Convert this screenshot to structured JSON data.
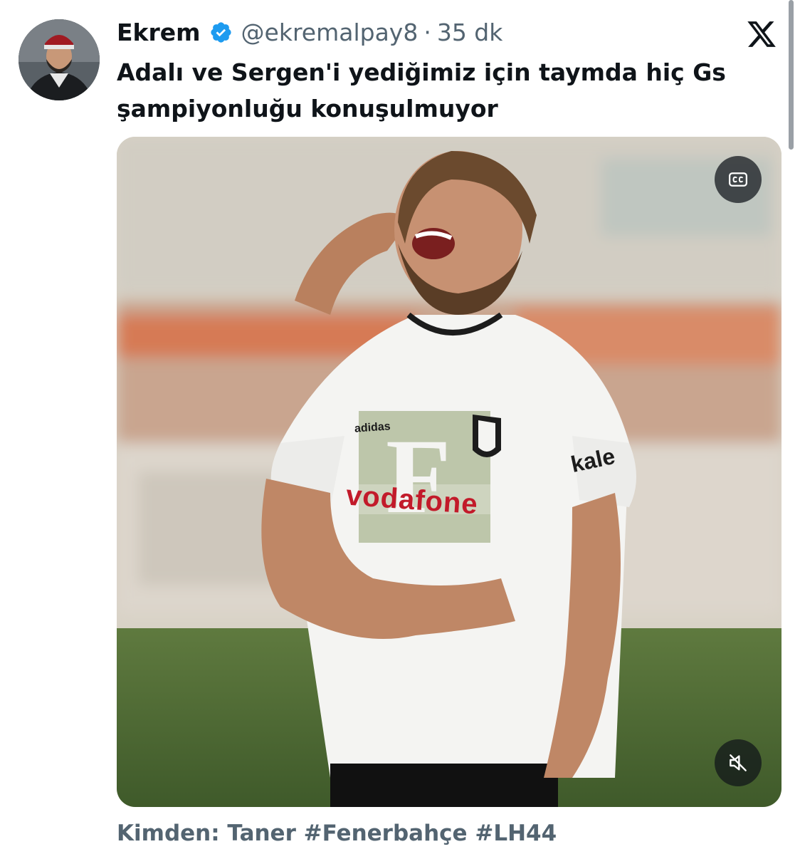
{
  "tweet": {
    "author": {
      "display_name": "Ekrem",
      "handle": "@ekremalpay8",
      "verified": true
    },
    "separator": "·",
    "time": "35 dk",
    "text": "Adalı ve Sergen'i yediğimiz için taymda hiç Gs şampiyonluğu konuşulmuyor",
    "media": {
      "type": "video",
      "watermark_letter": "F",
      "jersey_sponsor": "vodafone",
      "jersey_brand": "adidas",
      "sleeve_sponsor": "kale",
      "controls": [
        "closed-captions-icon",
        "muted-speaker-icon"
      ]
    },
    "credit": "Kimden: Taner #Fenerbahçe #LH44"
  },
  "colors": {
    "primary_text": "#0f1419",
    "secondary_text": "#536471",
    "verified_blue": "#1d9bf0"
  }
}
